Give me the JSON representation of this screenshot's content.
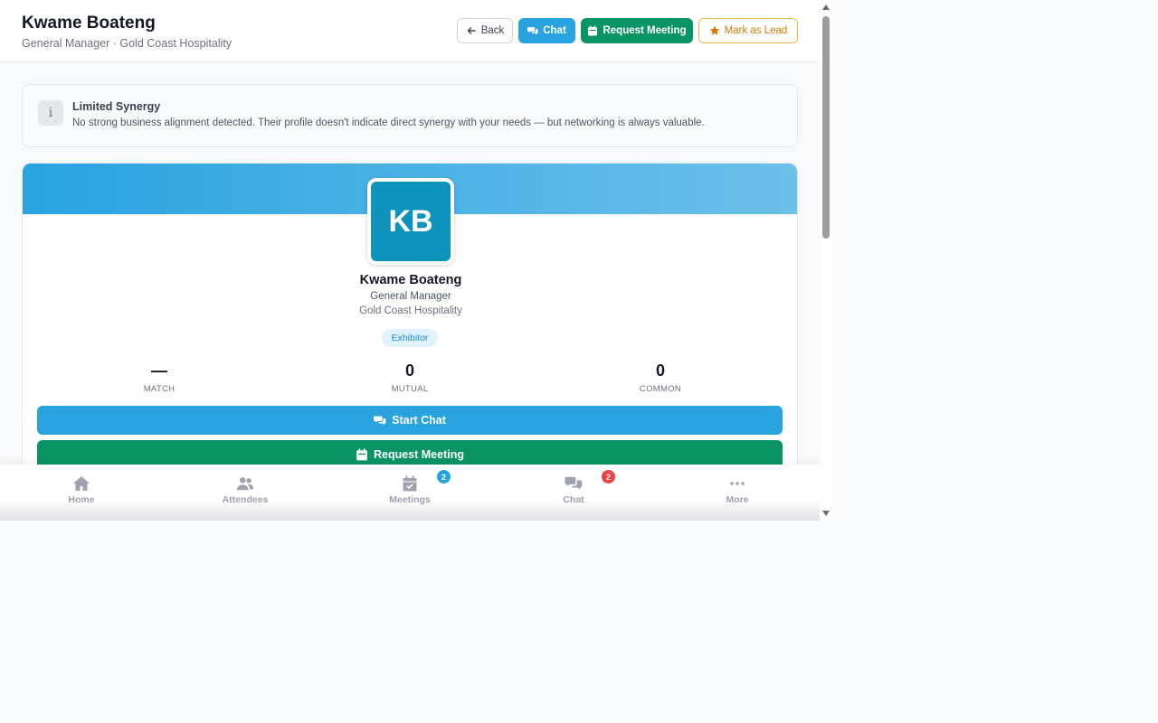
{
  "header": {
    "title": "Kwame Boateng",
    "subtitle": "General Manager · Gold Coast Hospitality",
    "buttons": {
      "back": "Back",
      "chat": "Chat",
      "request_meeting": "Request Meeting",
      "mark_lead": "Mark as Lead"
    }
  },
  "notice": {
    "icon": "info-icon",
    "title": "Limited Synergy",
    "text": "No strong business alignment detected. Their profile doesn't indicate direct synergy with your needs — but networking is always valuable."
  },
  "profile": {
    "initials": "KB",
    "name": "Kwame Boateng",
    "role": "General Manager",
    "company": "Gold Coast Hospitality",
    "badge": "Exhibitor",
    "stats": [
      {
        "value": "—",
        "label": "MATCH"
      },
      {
        "value": "0",
        "label": "MUTUAL"
      },
      {
        "value": "0",
        "label": "COMMON"
      }
    ],
    "actions": {
      "start_chat": "Start Chat",
      "request_meeting": "Request Meeting"
    }
  },
  "bottom_nav": [
    {
      "label": "Home",
      "icon": "home-icon"
    },
    {
      "label": "Attendees",
      "icon": "users-icon"
    },
    {
      "label": "Meetings",
      "icon": "calendar-check-icon",
      "badge": "2"
    },
    {
      "label": "Chat",
      "icon": "chat-icon",
      "badge": "2"
    },
    {
      "label": "More",
      "icon": "more-icon"
    }
  ],
  "colors": {
    "primary_blue": "#29a3e0",
    "primary_green": "#0a9463",
    "lead_orange": "#d97706",
    "avatar_teal": "#0e93bc",
    "badge_red": "#ef4444"
  }
}
